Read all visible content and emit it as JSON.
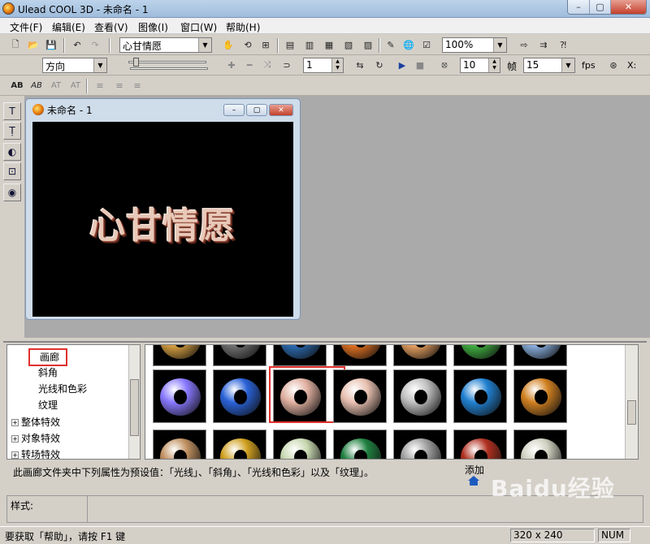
{
  "window": {
    "title": "Ulead COOL 3D - 未命名 - 1"
  },
  "menu": [
    "文件(F)",
    "编辑(E)",
    "查看(V)",
    "图像(I)",
    "窗口(W)",
    "帮助(H)"
  ],
  "toolbar1": {
    "text_combo": "心甘情愿",
    "zoom": "100%"
  },
  "toolbar2": {
    "mode_combo": "方向",
    "frame_value": "1",
    "fps_value": "10",
    "frame_label": "帧",
    "frames_combo": "15",
    "fps_label": "fps",
    "x_label": "X:"
  },
  "doc": {
    "title": "未命名 - 1",
    "art_text": "心甘情愿"
  },
  "tree": {
    "items": [
      "画廊",
      "斜角",
      "光线和色彩",
      "纹理",
      "整体特效",
      "对象特效",
      "转场特效"
    ]
  },
  "gallery_rows": [
    [
      "#d8a040",
      "#707070",
      "#2a6ab0",
      "#e07020",
      "#e8a060",
      "#40b040",
      "#8ab0e0"
    ],
    [
      "#8878ff",
      "#2a62d8",
      "#e0b0a0",
      "#e8c0b0",
      "#c0c0c0",
      "#2080d0",
      "#d08020"
    ],
    [
      "#c09060",
      "#d0a020",
      "#c8d8b0",
      "#208040",
      "#a0a0a0",
      "#b03020",
      "#d0d0c0"
    ]
  ],
  "description": "此画廊文件夹中下列属性为预设值：「光线」、「斜角」、「光线和色彩」以及「纹理」。",
  "add_label": "添加",
  "style_label": "样式:",
  "status": {
    "help": "要获取「帮助」，请按 F1 键",
    "size": "320 x 240",
    "num": "NUM"
  },
  "watermark": "Baidu经验",
  "colors": {
    "titlebar": "#a8c4e4",
    "workspace": "#aaaaaa",
    "highlight": "#e0302c"
  }
}
